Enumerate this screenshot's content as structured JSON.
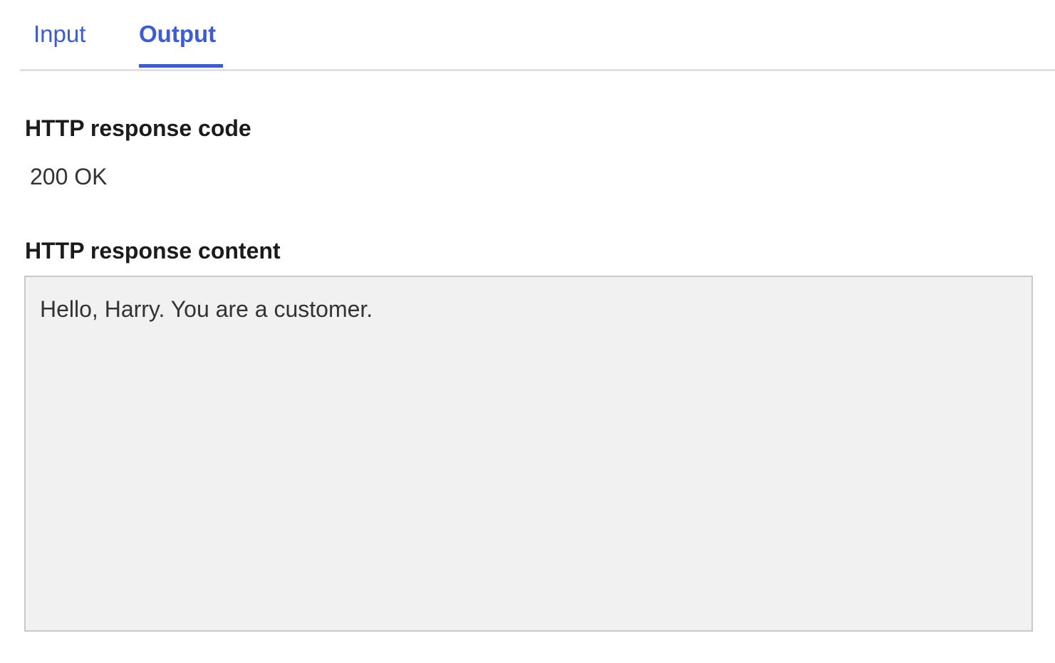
{
  "tabs": {
    "input_label": "Input",
    "output_label": "Output",
    "active": "Output"
  },
  "response": {
    "code_label": "HTTP response code",
    "code_value": "200 OK",
    "content_label": "HTTP response content",
    "content_value": "Hello, Harry. You are a customer."
  },
  "colors": {
    "accent": "#3b5bdb",
    "content_background": "#f1f1f1"
  }
}
